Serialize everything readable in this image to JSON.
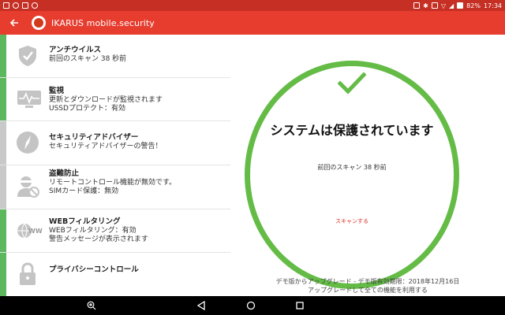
{
  "status_bar": {
    "time": "17:34",
    "battery": "82%",
    "left_icons": [
      "app-icon",
      "app-icon",
      "app-icon",
      "app-icon"
    ],
    "right_icons": [
      "cast-icon",
      "bluetooth-icon",
      "vibrate-icon",
      "wifi-icon",
      "signal-icon",
      "battery-icon"
    ]
  },
  "app_bar": {
    "title": "IKARUS mobile.security",
    "back_icon": "arrow-left-icon",
    "logo": "ikarus-logo"
  },
  "sidebar": {
    "items": [
      {
        "title": "アンチウイルス",
        "lines": [
          "前回のスキャン 38 秒前"
        ],
        "icon": "shield-icon",
        "status": "green"
      },
      {
        "title": "監視",
        "lines": [
          "更新とダウンロードが監視されます",
          "USSDプロテクト：有効"
        ],
        "icon": "monitor-pulse-icon",
        "status": "green"
      },
      {
        "title": "セキュリティアドバイザー",
        "lines": [
          "セキュリティアドバイザーの警告！"
        ],
        "icon": "compass-icon",
        "status": "grey"
      },
      {
        "title": "盗難防止",
        "lines": [
          "リモートコントロール機能が無効です。",
          "SIMカード保護：無効"
        ],
        "icon": "thief-icon",
        "status": "grey"
      },
      {
        "title": "WEBフィルタリング",
        "lines": [
          "WEBフィルタリング：有効",
          "警告メッセージが表示されます"
        ],
        "icon": "www-icon",
        "status": "green"
      },
      {
        "title": "プライバシーコントロール",
        "lines": [],
        "icon": "padlock-icon",
        "status": "green"
      }
    ]
  },
  "main": {
    "status_text": "システムは保護されています",
    "last_scan": "前回のスキャン 38 秒前",
    "scan_link": "スキャンする",
    "demo_line1": "デモ版からアップグレード - デモ版有効期限：2018年12月16日",
    "demo_line2": "アップグレードして全ての機能を利用する",
    "status_icon": "checkmark-icon"
  },
  "nav_bar": {
    "buttons": [
      "zoom-icon",
      "back-triangle-icon",
      "home-circle-icon",
      "recents-square-icon"
    ]
  },
  "colors": {
    "status_bar": "#c62f24",
    "app_bar": "#e63d2f",
    "ok_green": "#64bc46",
    "stripe_green": "#5cb85c",
    "stripe_grey": "#c9c9c9",
    "link_red": "#d9342a"
  }
}
